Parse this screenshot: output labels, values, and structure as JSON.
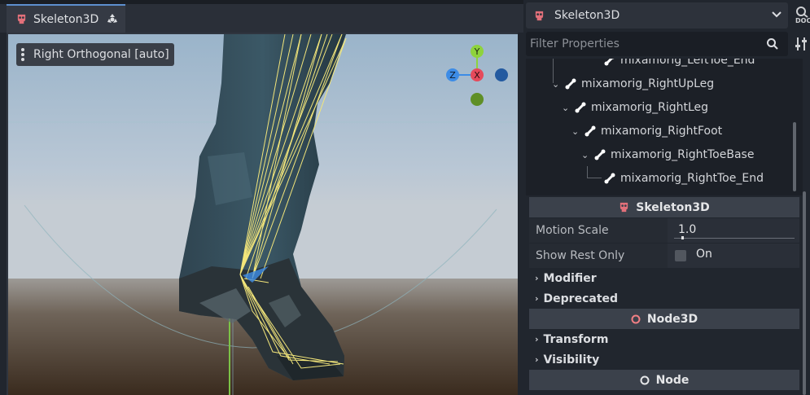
{
  "editor": {
    "tab_label": "Skeleton3D",
    "viewport_menu_label": "Right Orthogonal [auto]",
    "gizmo": {
      "y": "Y",
      "x": "X",
      "z": "Z"
    }
  },
  "inspector": {
    "object_label": "Skeleton3D",
    "doc_label": "DOC",
    "filter_placeholder": "Filter Properties",
    "tree_items": [
      {
        "label": "mixamorig_LeftToe_End"
      },
      {
        "label": "mixamorig_RightUpLeg"
      },
      {
        "label": "mixamorig_RightLeg"
      },
      {
        "label": "mixamorig_RightFoot"
      },
      {
        "label": "mixamorig_RightToeBase"
      },
      {
        "label": "mixamorig_RightToe_End"
      }
    ],
    "skeleton_section": "Skeleton3D",
    "motion_scale": {
      "label": "Motion Scale",
      "value": "1.0"
    },
    "show_rest_only": {
      "label": "Show Rest Only",
      "value": "On"
    },
    "groups1": {
      "modifier": "Modifier",
      "deprecated": "Deprecated"
    },
    "node3d_section": "Node3D",
    "groups2": {
      "transform": "Transform",
      "visibility": "Visibility"
    },
    "node_section": "Node"
  },
  "colors": {
    "accent": "#5d8fce",
    "skeleton_icon": "#e2707a",
    "axis_x": "#e54a5b",
    "axis_y": "#8ed33c",
    "axis_z": "#3d8ce6",
    "bones": "#f2e57a"
  }
}
